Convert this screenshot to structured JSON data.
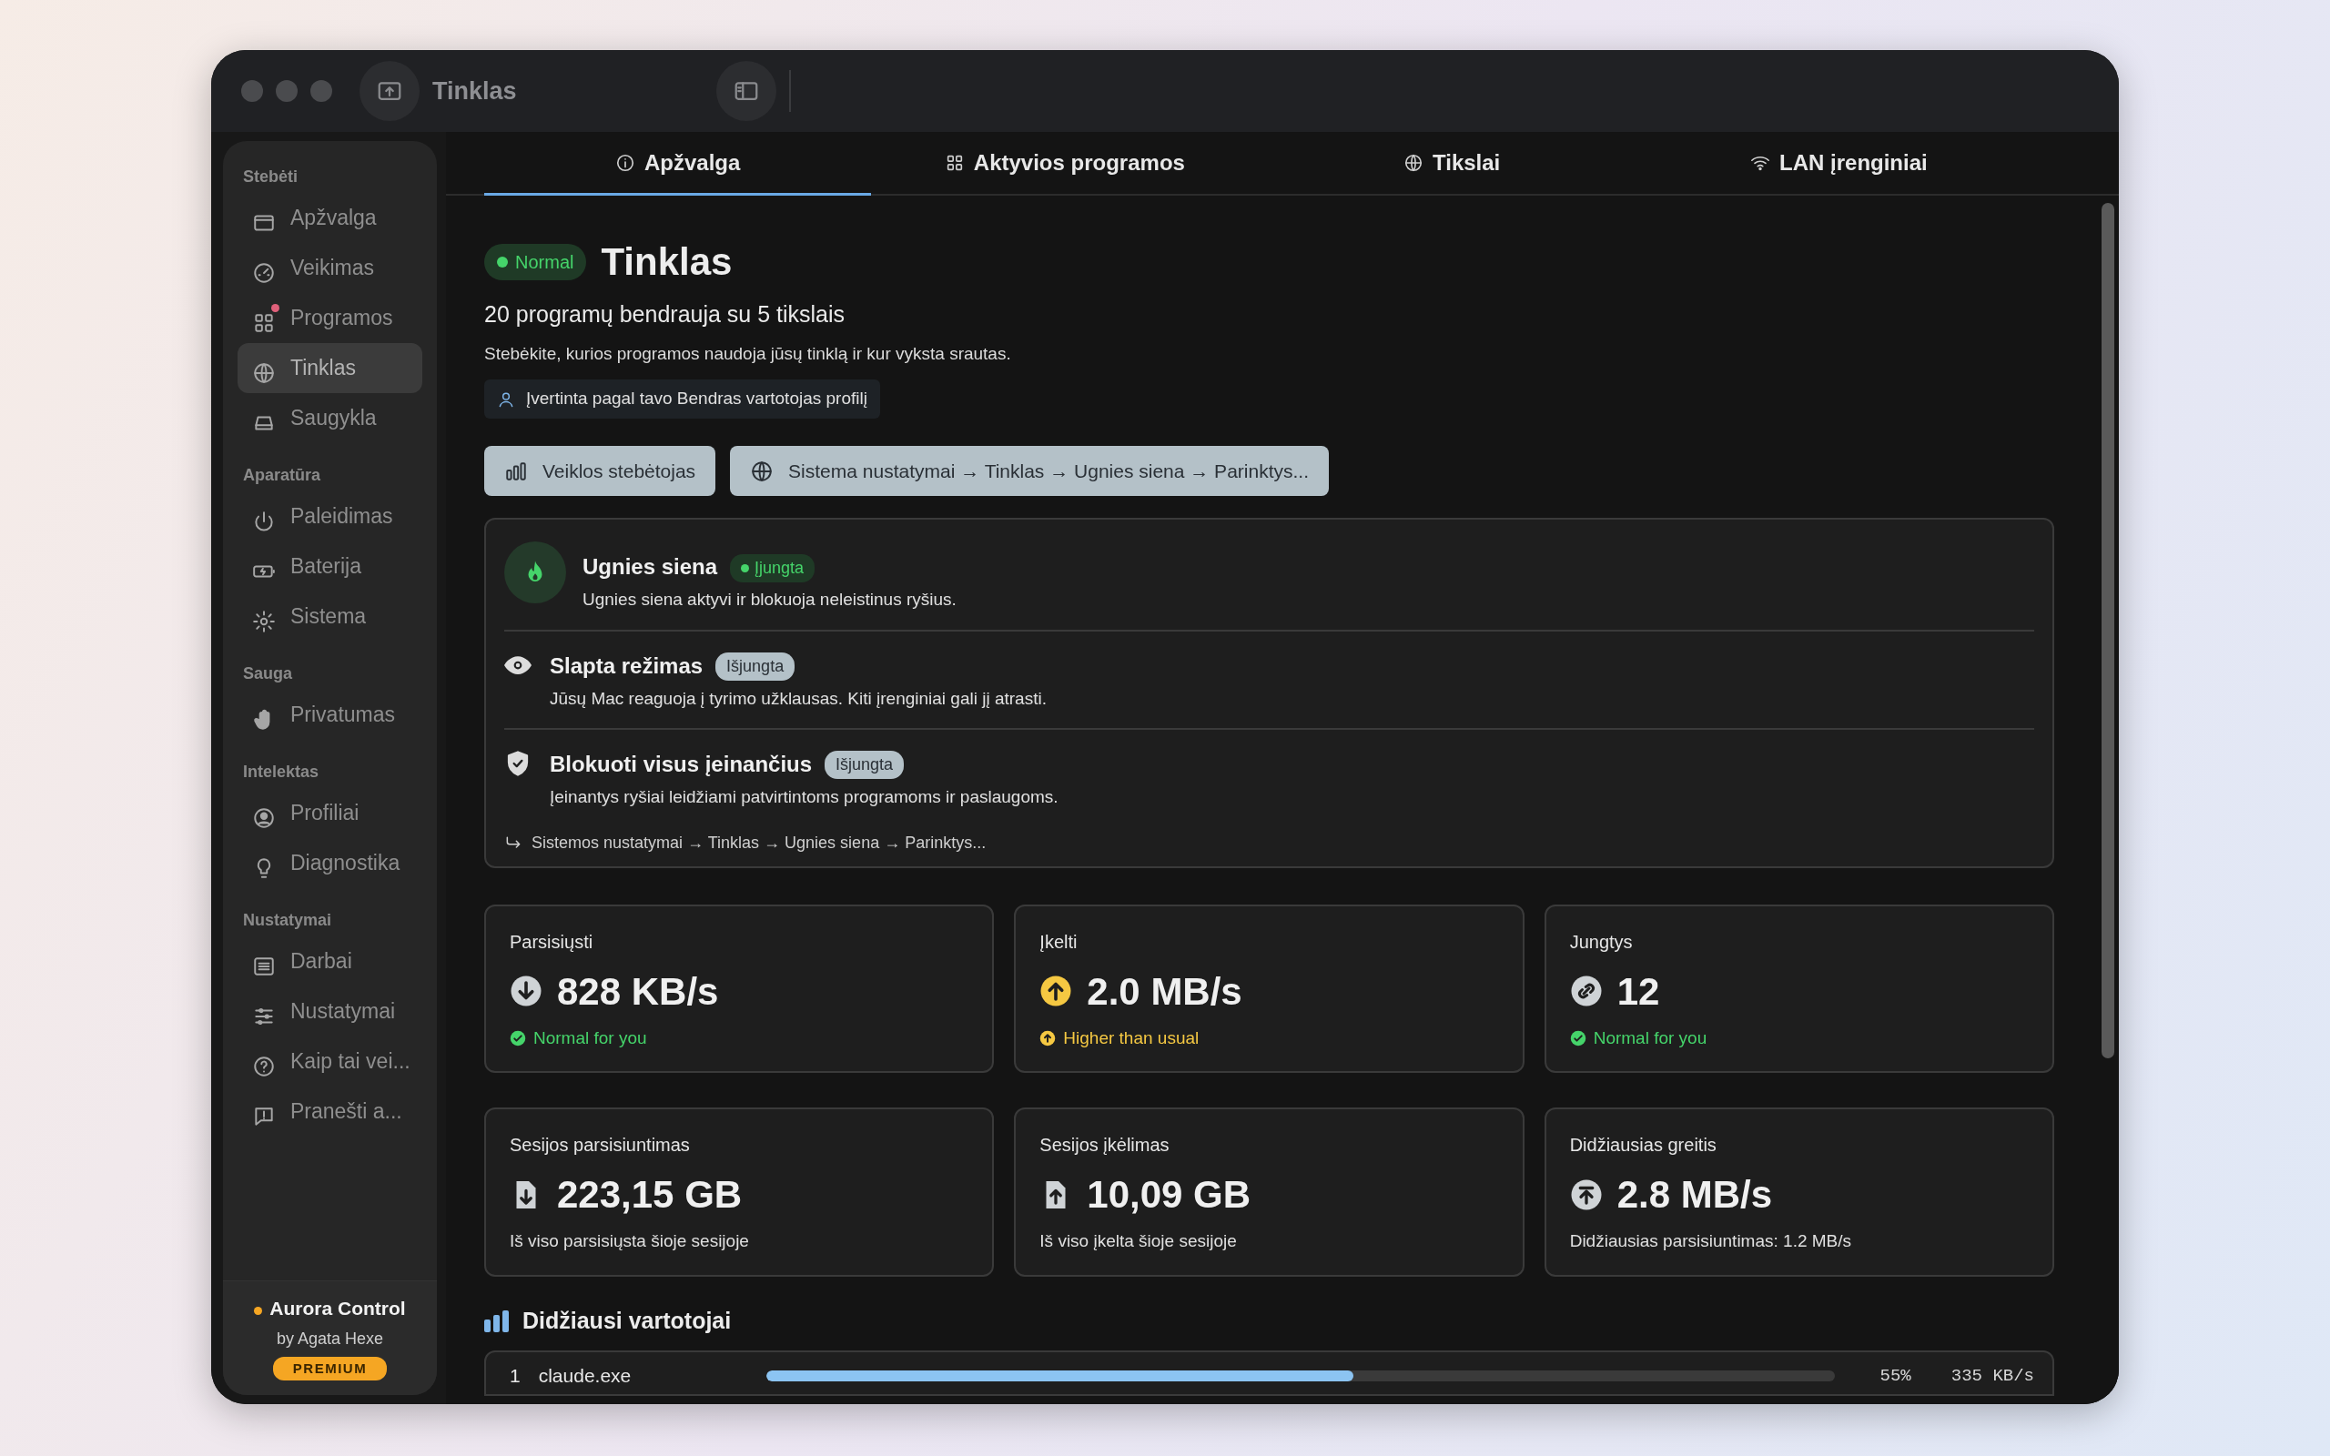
{
  "window": {
    "title": "Tinklas"
  },
  "sidebar": {
    "sections": [
      {
        "title": "Stebėti",
        "items": [
          {
            "label": "Apžvalga",
            "selected": false,
            "notification": false
          },
          {
            "label": "Veikimas",
            "selected": false,
            "notification": false
          },
          {
            "label": "Programos",
            "selected": false,
            "notification": true
          },
          {
            "label": "Tinklas",
            "selected": true,
            "notification": false
          },
          {
            "label": "Saugykla",
            "selected": false,
            "notification": false
          }
        ]
      },
      {
        "title": "Aparatūra",
        "items": [
          {
            "label": "Paleidimas",
            "selected": false,
            "notification": false
          },
          {
            "label": "Baterija",
            "selected": false,
            "notification": false
          },
          {
            "label": "Sistema",
            "selected": false,
            "notification": false
          }
        ]
      },
      {
        "title": "Sauga",
        "items": [
          {
            "label": "Privatumas",
            "selected": false,
            "notification": false
          }
        ]
      },
      {
        "title": "Intelektas",
        "items": [
          {
            "label": "Profiliai",
            "selected": false,
            "notification": false
          },
          {
            "label": "Diagnostika",
            "selected": false,
            "notification": false
          }
        ]
      },
      {
        "title": "Nustatymai",
        "items": [
          {
            "label": "Darbai",
            "selected": false,
            "notification": false
          },
          {
            "label": "Nustatymai",
            "selected": false,
            "notification": false
          },
          {
            "label": "Kaip tai vei...",
            "selected": false,
            "notification": false
          },
          {
            "label": "Pranešti a...",
            "selected": false,
            "notification": false
          }
        ]
      }
    ],
    "footer": {
      "app": "Aurora Control",
      "author": "by Agata Hexe",
      "badge": "PREMIUM"
    }
  },
  "tabs": [
    {
      "label": "Apžvalga",
      "selected": true
    },
    {
      "label": "Aktyvios programos",
      "selected": false
    },
    {
      "label": "Tikslai",
      "selected": false
    },
    {
      "label": "LAN įrenginiai",
      "selected": false
    }
  ],
  "header": {
    "status": "Normal",
    "title": "Tinklas",
    "subtitle": "20 programų bendrauja su 5 tikslais",
    "description": "Stebėkite, kurios programos naudoja jūsų tinklą ir kur vyksta srautas.",
    "profile_note": "Įvertinta pagal tavo Bendras vartotojas profilį",
    "buttons": [
      "Veiklos stebėtojas",
      "Sistema nustatymai → Tinklas → Ugnies siena → Parinktys..."
    ]
  },
  "firewall": {
    "items": [
      {
        "title": "Ugnies siena",
        "status": "Įjungta",
        "on": true,
        "description": "Ugnies siena aktyvi ir blokuoja neleistinus ryšius."
      },
      {
        "title": "Slapta režimas",
        "status": "Išjungta",
        "on": false,
        "description": "Jūsų Mac reaguoja į tyrimo užklausas. Kiti įrenginiai gali jį atrasti."
      },
      {
        "title": "Blokuoti visus įeinančius",
        "status": "Išjungta",
        "on": false,
        "description": "Įeinantys ryšiai leidžiami patvirtintoms programoms ir paslaugoms."
      }
    ],
    "path": "Sistemos nustatymai → Tinklas → Ugnies siena → Parinktys..."
  },
  "stats": [
    {
      "label": "Parsisiųsti",
      "value": "828 KB/s",
      "note": "Normal for you",
      "kind": "normal"
    },
    {
      "label": "Įkelti",
      "value": "2.0 MB/s",
      "note": "Higher than usual",
      "kind": "high"
    },
    {
      "label": "Jungtys",
      "value": "12",
      "note": "Normal for you",
      "kind": "normal"
    },
    {
      "label": "Sesijos parsisiuntimas",
      "value": "223,15 GB",
      "note": "Iš viso parsisiųsta šioje sesijoje"
    },
    {
      "label": "Sesijos įkėlimas",
      "value": "10,09 GB",
      "note": "Iš viso įkelta šioje sesijoje"
    },
    {
      "label": "Didžiausias greitis",
      "value": "2.8 MB/s",
      "note": "Didžiausias parsisiuntimas: 1.2 MB/s"
    }
  ],
  "top_users": {
    "title": "Didžiausi vartotojai",
    "rows": [
      {
        "rank": "1",
        "name": "claude.exe",
        "level": 0.55,
        "share": "55%",
        "rate": "335 KB/s"
      }
    ]
  }
}
